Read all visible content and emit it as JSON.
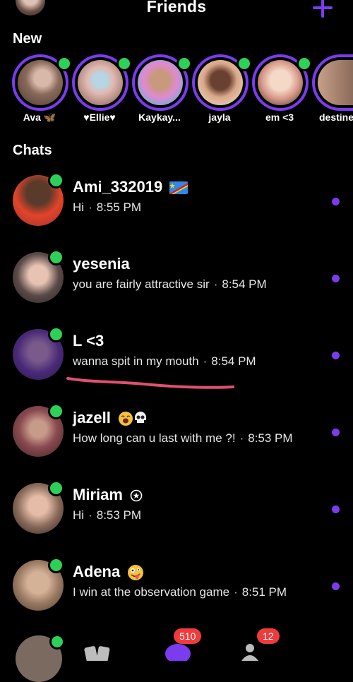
{
  "header": {
    "title": "Friends",
    "add_icon": "plus-icon"
  },
  "sections": {
    "new_label": "New",
    "chats_label": "Chats"
  },
  "colors": {
    "accent": "#7b3cf0",
    "online": "#2ed158",
    "badge": "#ef3b3b",
    "underline": "#e0506e"
  },
  "stories": [
    {
      "name": "Ava 🦋"
    },
    {
      "name": "♥Ellie♥"
    },
    {
      "name": "Kaykay..."
    },
    {
      "name": "jayla"
    },
    {
      "name": "em <3"
    },
    {
      "name": "destine"
    }
  ],
  "chats": [
    {
      "name": "Ami_332019",
      "badge_icon": "congo-flag-icon",
      "message": "Hi",
      "time": "8:55 PM"
    },
    {
      "name": "yesenia",
      "message": "you are fairly attractive sir",
      "time": "8:54 PM"
    },
    {
      "name": "L <3",
      "message": "wanna spit in my mouth",
      "time": "8:54 PM"
    },
    {
      "name": "jazell",
      "badge_icon": "yawning-face-and-skull-icons",
      "message": "How long can u last with me ?!",
      "time": "8:53 PM"
    },
    {
      "name": "Miriam",
      "badge_icon": "star-circle-icon",
      "message": "Hi",
      "time": "8:53 PM"
    },
    {
      "name": "Adena",
      "badge_icon": "zany-face-icon",
      "message": "I win at the observation game",
      "time": "8:51 PM"
    }
  ],
  "bottom_bar": {
    "chats_badge": "510",
    "friends_badge": "12"
  }
}
